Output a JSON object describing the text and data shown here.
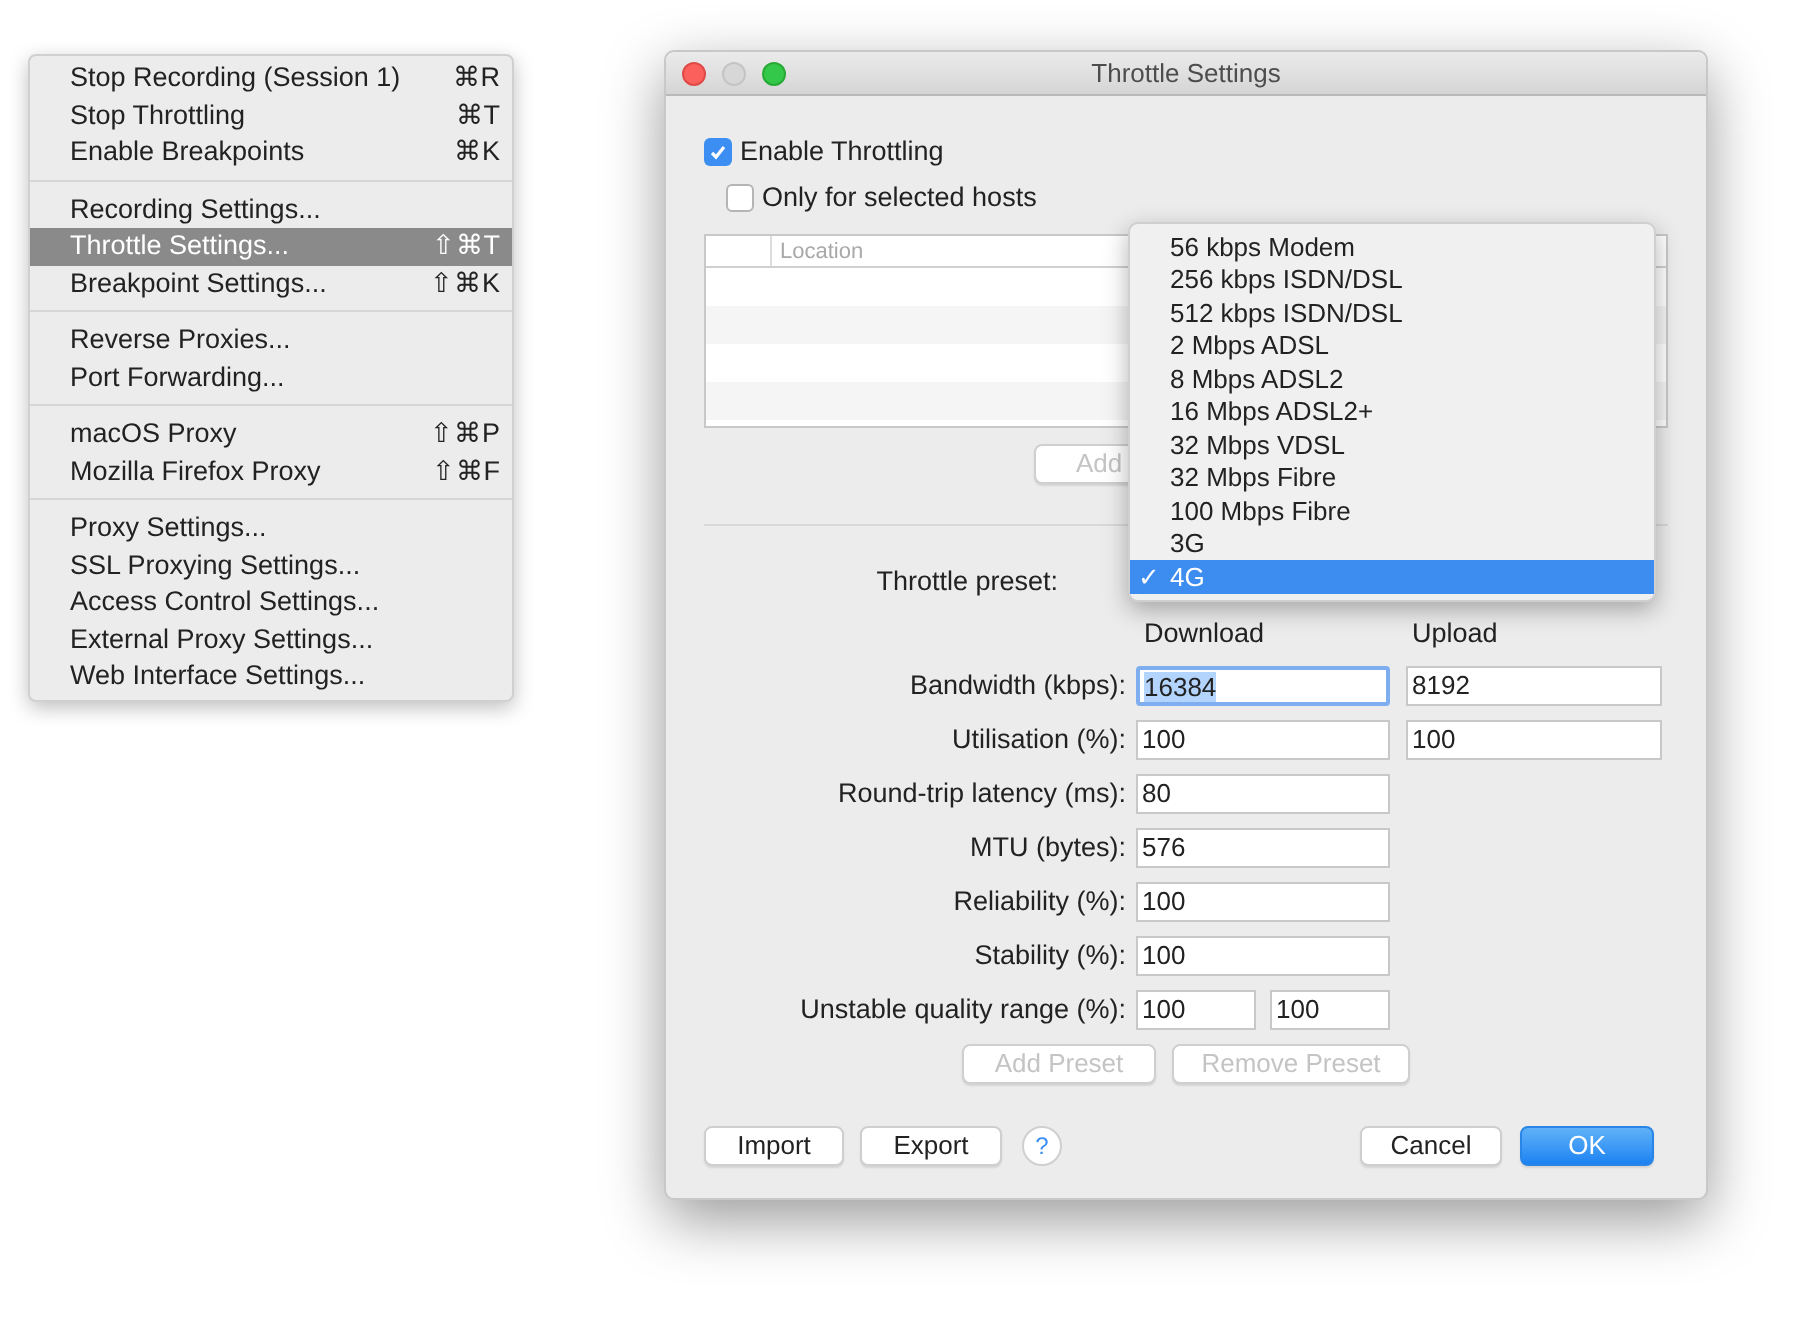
{
  "menu": {
    "sections": [
      {
        "items": [
          {
            "label": "Stop Recording (Session 1)",
            "shortcut": "⌘R",
            "selected": false
          },
          {
            "label": "Stop Throttling",
            "shortcut": "⌘T",
            "selected": false
          },
          {
            "label": "Enable Breakpoints",
            "shortcut": "⌘K",
            "selected": false
          }
        ]
      },
      {
        "items": [
          {
            "label": "Recording Settings...",
            "selected": false
          },
          {
            "label": "Throttle Settings...",
            "shortcut": "⇧⌘T",
            "selected": true
          },
          {
            "label": "Breakpoint Settings...",
            "shortcut": "⇧⌘K",
            "selected": false
          }
        ]
      },
      {
        "items": [
          {
            "label": "Reverse Proxies...",
            "selected": false
          },
          {
            "label": "Port Forwarding...",
            "selected": false
          }
        ]
      },
      {
        "items": [
          {
            "label": "macOS Proxy",
            "shortcut": "⇧⌘P",
            "selected": false
          },
          {
            "label": "Mozilla Firefox Proxy",
            "shortcut": "⇧⌘F",
            "selected": false
          }
        ]
      },
      {
        "items": [
          {
            "label": "Proxy Settings...",
            "selected": false
          },
          {
            "label": "SSL Proxying Settings...",
            "selected": false
          },
          {
            "label": "Access Control Settings...",
            "selected": false
          },
          {
            "label": "External Proxy Settings...",
            "selected": false
          },
          {
            "label": "Web Interface Settings...",
            "selected": false
          }
        ]
      }
    ]
  },
  "dialog": {
    "title": "Throttle Settings",
    "enable_throttling": {
      "label": "Enable Throttling",
      "checked": true
    },
    "only_selected_hosts": {
      "label": "Only for selected hosts",
      "checked": false
    },
    "hosts_table": {
      "columns": [
        "Location"
      ]
    },
    "add_button": {
      "label": "Add",
      "disabled": true
    },
    "throttle_preset": {
      "label": "Throttle preset:",
      "options": [
        {
          "label": "56 kbps Modem",
          "selected": false
        },
        {
          "label": "256 kbps ISDN/DSL",
          "selected": false
        },
        {
          "label": "512 kbps ISDN/DSL",
          "selected": false
        },
        {
          "label": "2 Mbps ADSL",
          "selected": false
        },
        {
          "label": "8 Mbps ADSL2",
          "selected": false
        },
        {
          "label": "16 Mbps ADSL2+",
          "selected": false
        },
        {
          "label": "32 Mbps VDSL",
          "selected": false
        },
        {
          "label": "32 Mbps Fibre",
          "selected": false
        },
        {
          "label": "100 Mbps Fibre",
          "selected": false
        },
        {
          "label": "3G",
          "selected": false
        },
        {
          "label": "4G",
          "selected": true
        }
      ],
      "check_mark": "✓"
    },
    "column_headers": [
      "Download",
      "Upload"
    ],
    "fields": [
      {
        "label": "Bandwidth (kbps):",
        "kind": "pair",
        "values": [
          {
            "value": "16384",
            "focused": true
          },
          {
            "value": "8192",
            "focused": false
          }
        ]
      },
      {
        "label": "Utilisation (%):",
        "kind": "pair",
        "values": [
          {
            "value": "100",
            "focused": false
          },
          {
            "value": "100",
            "focused": false
          }
        ]
      },
      {
        "label": "Round-trip latency (ms):",
        "kind": "single",
        "values": [
          {
            "value": "80",
            "focused": false
          }
        ]
      },
      {
        "label": "MTU (bytes):",
        "kind": "single",
        "values": [
          {
            "value": "576",
            "focused": false
          }
        ]
      },
      {
        "label": "Reliability (%):",
        "kind": "single",
        "values": [
          {
            "value": "100",
            "focused": false
          }
        ]
      },
      {
        "label": "Stability (%):",
        "kind": "single",
        "values": [
          {
            "value": "100",
            "focused": false
          }
        ]
      },
      {
        "label": "Unstable quality range (%):",
        "kind": "range",
        "values": [
          {
            "value": "100",
            "focused": false
          },
          {
            "value": "100",
            "focused": false
          }
        ]
      }
    ],
    "preset_buttons": [
      {
        "label": "Add Preset",
        "disabled": true
      },
      {
        "label": "Remove Preset",
        "disabled": true
      }
    ],
    "footer_left": [
      {
        "label": "Import"
      },
      {
        "label": "Export"
      }
    ],
    "help": "?",
    "footer_right": [
      {
        "label": "Cancel",
        "primary": false
      },
      {
        "label": "OK",
        "primary": true
      }
    ]
  }
}
